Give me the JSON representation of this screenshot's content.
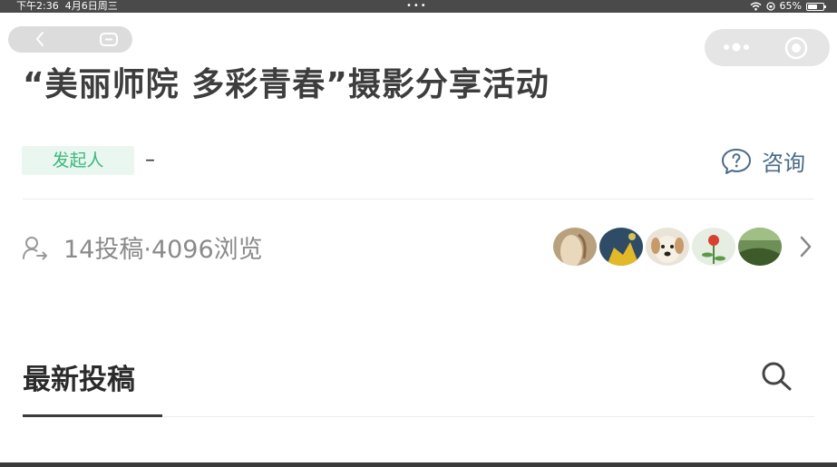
{
  "status_bar": {
    "time": "下午2:36",
    "date": "4月6日周三",
    "dots": "•••",
    "battery": "65%",
    "battery_level": 0.65
  },
  "nav": {
    "back_icon": "chevron-left-icon",
    "home_icon": "home-icon"
  },
  "capsule": {
    "more_icon": "more-dots-icon",
    "close_icon": "target-close-icon"
  },
  "activity": {
    "title": "“美丽师院 多彩青春”摄影分享活动",
    "organizer_tag": "发起人",
    "organizer_name": "–",
    "consult_label": "咨询",
    "stats_text": "14投稿·4096浏览"
  },
  "participants": [
    {
      "name": "participant-1",
      "color": "#c9b28f"
    },
    {
      "name": "participant-2",
      "color": "#2f4f6b"
    },
    {
      "name": "participant-3",
      "color": "#e9e2d8"
    },
    {
      "name": "participant-4",
      "color": "#dfe8dc"
    },
    {
      "name": "participant-5",
      "color": "#4a6a3a"
    }
  ],
  "section": {
    "title": "最新投稿"
  },
  "colors": {
    "accent_green": "#3bb77e",
    "tag_bg": "#eaf7f1",
    "consult_blue": "#4a6b87"
  }
}
